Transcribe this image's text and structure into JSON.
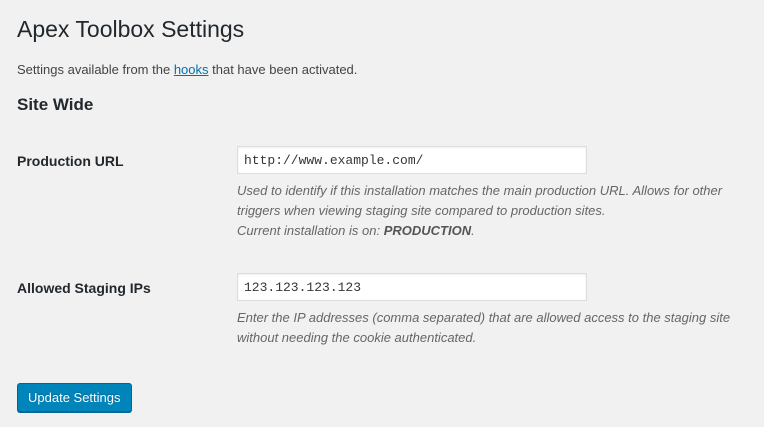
{
  "page": {
    "title": "Apex Toolbox Settings",
    "intro_prefix": "Settings available from the ",
    "intro_link": "hooks",
    "intro_suffix": " that have been activated."
  },
  "section": {
    "title": "Site Wide"
  },
  "fields": {
    "production_url": {
      "label": "Production URL",
      "value": "http://www.example.com/",
      "description_line1": "Used to identify if this installation matches the main production URL. Allows for other triggers when viewing staging site compared to production sites.",
      "current_prefix": "Current installation is on: ",
      "current_value": "PRODUCTION",
      "current_suffix": "."
    },
    "staging_ips": {
      "label": "Allowed Staging IPs",
      "value": "123.123.123.123",
      "description": "Enter the IP addresses (comma separated) that are allowed access to the staging site without needing the cookie authenticated."
    }
  },
  "actions": {
    "submit_label": "Update Settings"
  },
  "colors": {
    "primary_button": "#0085ba",
    "link": "#0073aa",
    "background": "#f1f1f1"
  }
}
